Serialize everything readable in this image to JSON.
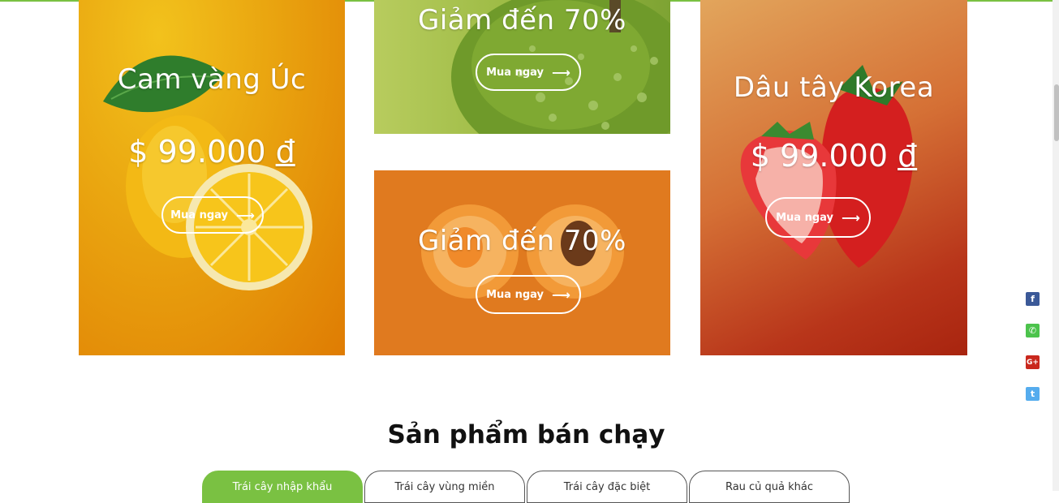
{
  "promos": {
    "lemon": {
      "title": "Cam vàng Úc",
      "price": "$ 99.000",
      "currency": "đ",
      "button": "Mua ngay"
    },
    "pear": {
      "title": "Giảm đến 70%",
      "button": "Mua ngay"
    },
    "apricot": {
      "title": "Giảm đến 70%",
      "button": "Mua ngay"
    },
    "strawberry": {
      "title": "Dâu tây Korea",
      "price": "$ 99.000",
      "currency": "đ",
      "button": "Mua ngay"
    }
  },
  "section": {
    "title": "Sản phẩm bán chạy"
  },
  "tabs": [
    {
      "label": "Trái cây nhập khẩu",
      "active": true
    },
    {
      "label": "Trái cây vùng miền",
      "active": false
    },
    {
      "label": "Trái cây đặc biệt",
      "active": false
    },
    {
      "label": "Rau củ quả khác",
      "active": false
    }
  ],
  "social": [
    {
      "icon": "facebook-icon",
      "glyph": "f",
      "color": "#3b5998"
    },
    {
      "icon": "phone-icon",
      "glyph": "✆",
      "color": "#4cc34c"
    },
    {
      "icon": "google-plus-icon",
      "glyph": "G+",
      "color": "#c9281d"
    },
    {
      "icon": "twitter-icon",
      "glyph": "t",
      "color": "#55acee"
    }
  ],
  "colors": {
    "accent": "#7ac142"
  }
}
